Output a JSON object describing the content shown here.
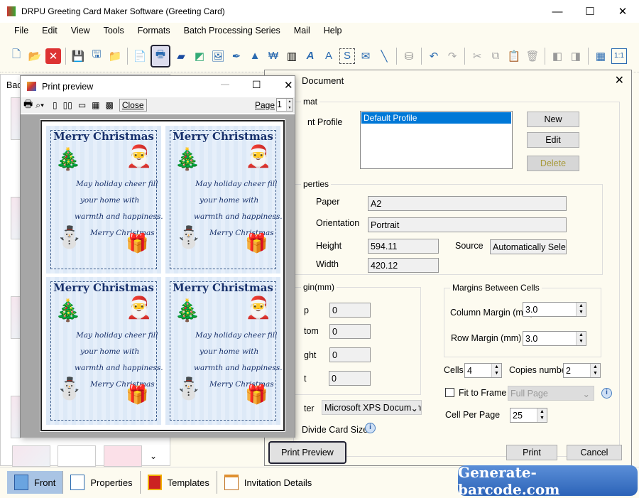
{
  "app": {
    "title": "DRPU Greeting Card Maker Software (Greeting Card)"
  },
  "menu": [
    "File",
    "Edit",
    "View",
    "Tools",
    "Formats",
    "Batch Processing Series",
    "Mail",
    "Help"
  ],
  "left_panel": {
    "label": "Bac"
  },
  "bottom_tabs": [
    {
      "label": "Front",
      "active": true
    },
    {
      "label": "Properties"
    },
    {
      "label": "Templates"
    },
    {
      "label": "Invitation Details"
    }
  ],
  "print_dialog": {
    "title": "Document",
    "format_group": "mat",
    "profile_label": "nt Profile",
    "profiles": [
      "Default Profile"
    ],
    "new": "New",
    "edit": "Edit",
    "delete": "Delete",
    "props_group": "perties",
    "paper_label": "Paper",
    "paper": "A2",
    "orientation_label": "Orientation",
    "orientation": "Portrait",
    "height_label": "Height",
    "height": "594.11",
    "source_label": "Source",
    "source": "Automatically Sele",
    "width_label": "Width",
    "width": "420.12",
    "margin_group": "gin(mm)",
    "top_label": "p",
    "top": "0",
    "bottom_label": "tom",
    "bottom": "0",
    "right_label": "ght",
    "right": "0",
    "left_label": "t",
    "left": "0",
    "cells_group": "Margins Between Cells",
    "column_margin_label": "Column Margin (mm)",
    "column_margin": "3.0",
    "row_margin_label": "Row Margin (mm)",
    "row_margin": "3.0",
    "cells_label": "Cells",
    "cells": "4",
    "copies_label": "Copies number",
    "copies": "2",
    "fit_label": "Fit to Frame",
    "fit_checked": false,
    "fit_option": "Full Page",
    "cell_per_page_label": "Cell Per Page",
    "cell_per_page": "25",
    "printer_label": "ter",
    "printer": "Microsoft XPS Document",
    "divide_label": "Divide Card Size",
    "print_preview": "Print Preview",
    "print": "Print",
    "cancel": "Cancel"
  },
  "preview": {
    "title": "Print preview",
    "close": "Close",
    "page_label": "Page",
    "page": "1"
  },
  "card": {
    "title": "Merry Christmas",
    "lines": [
      "May holiday cheer fill",
      "your home with",
      "warmth and happiness.",
      "Merry Christmas"
    ]
  },
  "watermark": "Generate-barcode.com"
}
